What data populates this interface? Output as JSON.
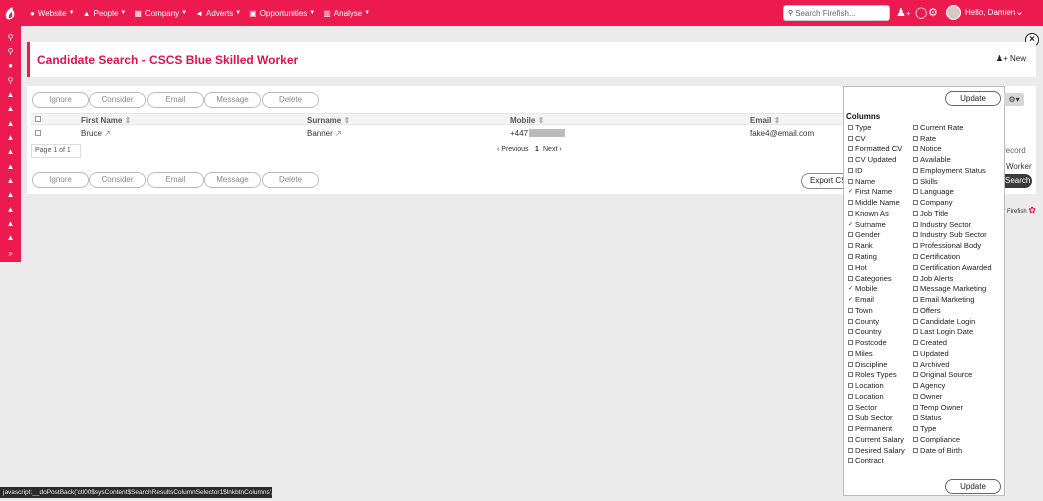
{
  "nav": {
    "items": [
      {
        "icon": "globe-icon",
        "glyph": "●",
        "label": "Website"
      },
      {
        "icon": "person-icon",
        "glyph": "▲",
        "label": "People"
      },
      {
        "icon": "building-icon",
        "glyph": "▦",
        "label": "Company"
      },
      {
        "icon": "megaphone-icon",
        "glyph": "◄",
        "label": "Adverts"
      },
      {
        "icon": "briefcase-icon",
        "glyph": "▣",
        "label": "Opportunities"
      },
      {
        "icon": "chart-icon",
        "glyph": "▥",
        "label": "Analyse"
      }
    ],
    "search_placeholder": "Search Firefish...",
    "greeting": "Hello, Damien"
  },
  "page": {
    "title": "Candidate Search - CSCS Blue Skilled Worker",
    "new_label": "New"
  },
  "actions": {
    "top": [
      "Ignore",
      "Consider",
      "Email",
      "Message",
      "Delete"
    ],
    "bottom": [
      "Ignore",
      "Consider",
      "Email",
      "Message",
      "Delete"
    ]
  },
  "table": {
    "headers": {
      "first_name": "First Name",
      "surname": "Surname",
      "mobile": "Mobile",
      "email": "Email"
    },
    "row": {
      "first_name": "Bruce",
      "surname": "Banner",
      "mobile": "+447",
      "email": "fake4@email.com"
    }
  },
  "pager": {
    "info": "Page 1 of 1",
    "previous": "‹ Previous",
    "current": "1",
    "next": "Next ›"
  },
  "partials": {
    "record": "record",
    "worker": "Worker",
    "export": "Export CS",
    "search": "Search"
  },
  "footer": {
    "powered": "by Firefish"
  },
  "columns_panel": {
    "update_label": "Update",
    "title": "Columns",
    "left": [
      {
        "label": "Type",
        "checked": false
      },
      {
        "label": "CV",
        "checked": false
      },
      {
        "label": "Formatted CV",
        "checked": false
      },
      {
        "label": "CV Updated",
        "checked": false
      },
      {
        "label": "ID",
        "checked": false
      },
      {
        "label": "Name",
        "checked": false
      },
      {
        "label": "First Name",
        "checked": true
      },
      {
        "label": "Middle Name",
        "checked": false
      },
      {
        "label": "Known As",
        "checked": false
      },
      {
        "label": "Surname",
        "checked": true
      },
      {
        "label": "Gender",
        "checked": false
      },
      {
        "label": "Rank",
        "checked": false
      },
      {
        "label": "Rating",
        "checked": false
      },
      {
        "label": "Hot",
        "checked": false
      },
      {
        "label": "Categories",
        "checked": false
      },
      {
        "label": "Mobile",
        "checked": true
      },
      {
        "label": "Email",
        "checked": true
      },
      {
        "label": "Town",
        "checked": false
      },
      {
        "label": "County",
        "checked": false
      },
      {
        "label": "Country",
        "checked": false
      },
      {
        "label": "Postcode",
        "checked": false
      },
      {
        "label": "Miles",
        "checked": false
      },
      {
        "label": "Discipline",
        "checked": false
      },
      {
        "label": "Roles Types",
        "checked": false
      },
      {
        "label": "Location",
        "checked": false
      },
      {
        "label": "Location",
        "checked": false
      },
      {
        "label": "Sector",
        "checked": false
      },
      {
        "label": "Sub Sector",
        "checked": false
      },
      {
        "label": "Permanent",
        "checked": false
      },
      {
        "label": "Current Salary",
        "checked": false
      },
      {
        "label": "Desired Salary",
        "checked": false
      },
      {
        "label": "Contract",
        "checked": false
      }
    ],
    "right": [
      {
        "label": "Current Rate",
        "checked": false
      },
      {
        "label": "Rate",
        "checked": false
      },
      {
        "label": "Notice",
        "checked": false
      },
      {
        "label": "Available",
        "checked": false
      },
      {
        "label": "Employment Status",
        "checked": false
      },
      {
        "label": "Skills",
        "checked": false
      },
      {
        "label": "Language",
        "checked": false
      },
      {
        "label": "Company",
        "checked": false
      },
      {
        "label": "Job Title",
        "checked": false
      },
      {
        "label": "Industry Sector",
        "checked": false
      },
      {
        "label": "Industry Sub Sector",
        "checked": false
      },
      {
        "label": "Professional Body",
        "checked": false
      },
      {
        "label": "Certification",
        "checked": false
      },
      {
        "label": "Certification Awarded",
        "checked": false
      },
      {
        "label": "Job Alerts",
        "checked": false
      },
      {
        "label": "Message Marketing",
        "checked": false
      },
      {
        "label": "Email Marketing",
        "checked": false
      },
      {
        "label": "Offers",
        "checked": false
      },
      {
        "label": "Candidate Login",
        "checked": false
      },
      {
        "label": "Last Login Date",
        "checked": false
      },
      {
        "label": "Created",
        "checked": false
      },
      {
        "label": "Updated",
        "checked": false
      },
      {
        "label": "Archived",
        "checked": false
      },
      {
        "label": "Original Source",
        "checked": false
      },
      {
        "label": "Agency",
        "checked": false
      },
      {
        "label": "Owner",
        "checked": false
      },
      {
        "label": "Temp Owner",
        "checked": false
      },
      {
        "label": "Status",
        "checked": false
      },
      {
        "label": "Type",
        "checked": false
      },
      {
        "label": "Compliance",
        "checked": false
      },
      {
        "label": "Date of Birth",
        "checked": false
      }
    ]
  },
  "statusbar": {
    "text": "javascript:__doPostBack('ctl00$sysContent$SearchResultsColumnSelector1$lnkbtnColumns','')"
  },
  "colors": {
    "brand": "#ed1a4f",
    "title": "#e2114a"
  }
}
